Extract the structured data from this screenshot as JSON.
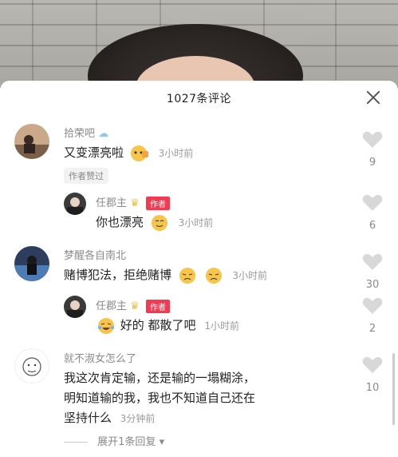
{
  "header": {
    "title": "1027条评论"
  },
  "comments": [
    {
      "user": "拾荣吧",
      "text": "又变漂亮啦",
      "time": "3小时前",
      "likes": "9",
      "liked_by": "作者赞过"
    },
    {
      "user": "任郡主",
      "author_tag": "作者",
      "text": "你也漂亮",
      "time": "3小时前",
      "likes": "6"
    },
    {
      "user": "梦醒各自南北",
      "text": "赌博犯法，拒绝赌博",
      "time": "3小时前",
      "likes": "30"
    },
    {
      "user": "任郡主",
      "author_tag": "作者",
      "text": "好的 都散了吧",
      "time": "1小时前",
      "likes": "2"
    },
    {
      "user": "就不淑女怎么了",
      "text_line1": "我这次肯定输，还是输的一塌糊涂，",
      "text_line2": "明知道输的我，我也不知道自己还在",
      "text_line3": "坚持什么",
      "time": "3分钟前",
      "likes": "10"
    }
  ],
  "expand_label": "展开1条回复",
  "colors": {
    "author_tag": "#f23a52",
    "like_icon": "#d8d8d8"
  }
}
